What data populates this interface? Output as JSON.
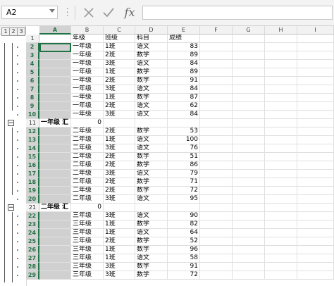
{
  "formula_bar": {
    "name_box": "A2",
    "cancel_icon": "x-icon",
    "enter_icon": "check-icon",
    "fx_label": "fx",
    "formula": ""
  },
  "outline_levels": [
    "1",
    "2",
    "3"
  ],
  "columns": [
    "A",
    "B",
    "C",
    "D",
    "E",
    "F",
    "G",
    "H",
    "I"
  ],
  "selected_column": "A",
  "selected_cell": "A2",
  "rows": [
    {
      "n": "1",
      "b": "年级",
      "c": "班级",
      "d": "科目",
      "e": "成绩"
    },
    {
      "n": "2",
      "b": "一年级",
      "c": "1班",
      "d": "语文",
      "e": "83"
    },
    {
      "n": "3",
      "b": "一年级",
      "c": "2班",
      "d": "数学",
      "e": "89"
    },
    {
      "n": "4",
      "b": "一年级",
      "c": "3班",
      "d": "语文",
      "e": "84"
    },
    {
      "n": "5",
      "b": "一年级",
      "c": "1班",
      "d": "数学",
      "e": "89"
    },
    {
      "n": "6",
      "b": "一年级",
      "c": "2班",
      "d": "数学",
      "e": "91"
    },
    {
      "n": "7",
      "b": "一年级",
      "c": "3班",
      "d": "语文",
      "e": "84"
    },
    {
      "n": "8",
      "b": "一年级",
      "c": "1班",
      "d": "数学",
      "e": "87"
    },
    {
      "n": "9",
      "b": "一年级",
      "c": "2班",
      "d": "语文",
      "e": "62"
    },
    {
      "n": "10",
      "b": "一年级",
      "c": "3班",
      "d": "语文",
      "e": "84"
    },
    {
      "n": "11",
      "a": "一年级 汇",
      "b": "0",
      "c": "",
      "d": "",
      "e": "",
      "summary": true
    },
    {
      "n": "12",
      "b": "二年级",
      "c": "2班",
      "d": "数学",
      "e": "53"
    },
    {
      "n": "13",
      "b": "二年级",
      "c": "1班",
      "d": "语文",
      "e": "100"
    },
    {
      "n": "14",
      "b": "二年级",
      "c": "3班",
      "d": "语文",
      "e": "76"
    },
    {
      "n": "15",
      "b": "二年级",
      "c": "2班",
      "d": "数学",
      "e": "51"
    },
    {
      "n": "16",
      "b": "二年级",
      "c": "2班",
      "d": "数学",
      "e": "86"
    },
    {
      "n": "17",
      "b": "二年级",
      "c": "3班",
      "d": "语文",
      "e": "79"
    },
    {
      "n": "18",
      "b": "二年级",
      "c": "2班",
      "d": "数学",
      "e": "71"
    },
    {
      "n": "19",
      "b": "二年级",
      "c": "2班",
      "d": "数学",
      "e": "72"
    },
    {
      "n": "20",
      "b": "二年级",
      "c": "3班",
      "d": "语文",
      "e": "95"
    },
    {
      "n": "21",
      "a": "二年级 汇",
      "b": "0",
      "c": "",
      "d": "",
      "e": "",
      "summary": true
    },
    {
      "n": "22",
      "b": "三年级",
      "c": "3班",
      "d": "语文",
      "e": "90"
    },
    {
      "n": "23",
      "b": "三年级",
      "c": "1班",
      "d": "数学",
      "e": "82"
    },
    {
      "n": "24",
      "b": "三年级",
      "c": "1班",
      "d": "语文",
      "e": "64"
    },
    {
      "n": "25",
      "b": "三年级",
      "c": "2班",
      "d": "数学",
      "e": "52"
    },
    {
      "n": "26",
      "b": "三年级",
      "c": "1班",
      "d": "数学",
      "e": "96"
    },
    {
      "n": "27",
      "b": "三年级",
      "c": "1班",
      "d": "语文",
      "e": "58"
    },
    {
      "n": "28",
      "b": "三年级",
      "c": "3班",
      "d": "数学",
      "e": "91"
    },
    {
      "n": "29",
      "b": "三年级",
      "c": "3班",
      "d": "数学",
      "e": "72"
    }
  ]
}
